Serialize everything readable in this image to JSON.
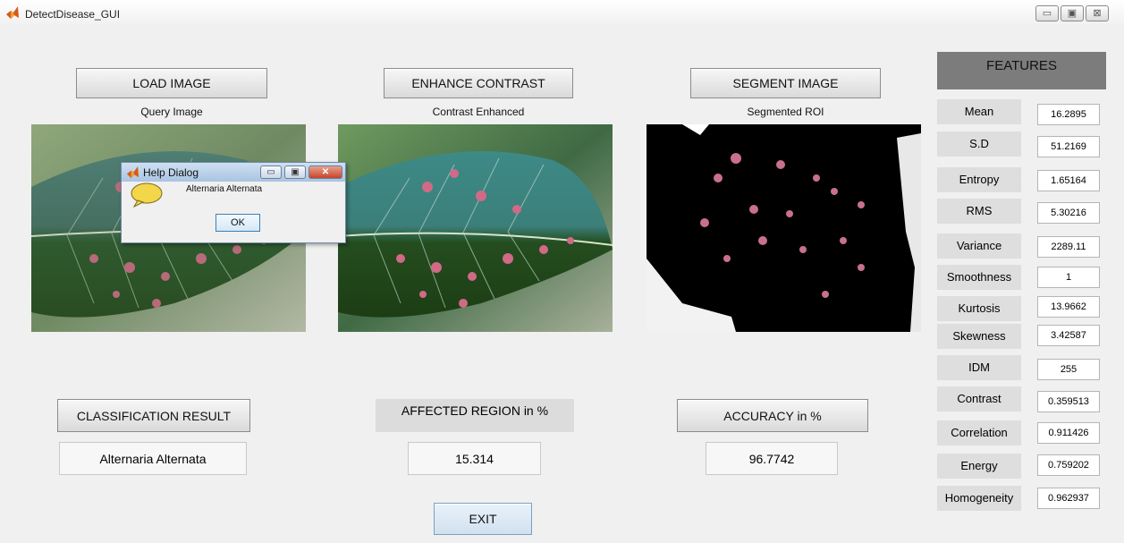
{
  "window": {
    "title": "DetectDisease_GUI",
    "controls": {
      "minimize": "▭",
      "maximize": "▣",
      "close": "⊠"
    }
  },
  "buttons": {
    "load_image": "LOAD IMAGE",
    "enhance_contrast": "ENHANCE CONTRAST",
    "segment_image": "SEGMENT IMAGE",
    "classification_result": "CLASSIFICATION RESULT",
    "accuracy": "ACCURACY in %",
    "exit": "EXIT"
  },
  "image_labels": {
    "query": "Query Image",
    "enhanced": "Contrast Enhanced",
    "segmented": "Segmented ROI"
  },
  "affected_region_label": "AFFECTED REGION in %",
  "results": {
    "classification": "Alternaria Alternata",
    "affected_region": "15.314",
    "accuracy": "96.7742"
  },
  "features": {
    "header": "FEATURES",
    "items": [
      {
        "name": "Mean",
        "value": "16.2895"
      },
      {
        "name": "S.D",
        "value": "51.2169"
      },
      {
        "name": "Entropy",
        "value": "1.65164"
      },
      {
        "name": "RMS",
        "value": "5.30216"
      },
      {
        "name": "Variance",
        "value": "2289.11"
      },
      {
        "name": "Smoothness",
        "value": "1"
      },
      {
        "name": "Kurtosis",
        "value": "13.9662"
      },
      {
        "name": "Skewness",
        "value": "3.42587"
      },
      {
        "name": "IDM",
        "value": "255"
      },
      {
        "name": "Contrast",
        "value": "0.359513"
      },
      {
        "name": "Correlation",
        "value": "0.911426"
      },
      {
        "name": "Energy",
        "value": "0.759202"
      },
      {
        "name": "Homogeneity",
        "value": "0.962937"
      }
    ]
  },
  "help_dialog": {
    "title": "Help Dialog",
    "message": "Alternaria Alternata",
    "ok_label": "OK",
    "controls": {
      "minimize": "▭",
      "maximize": "▣",
      "close": "✕"
    }
  },
  "colors": {
    "window_bg": "#f0f0f0",
    "features_header_bg": "#7c7c7c",
    "feature_name_bg": "#dedede"
  }
}
